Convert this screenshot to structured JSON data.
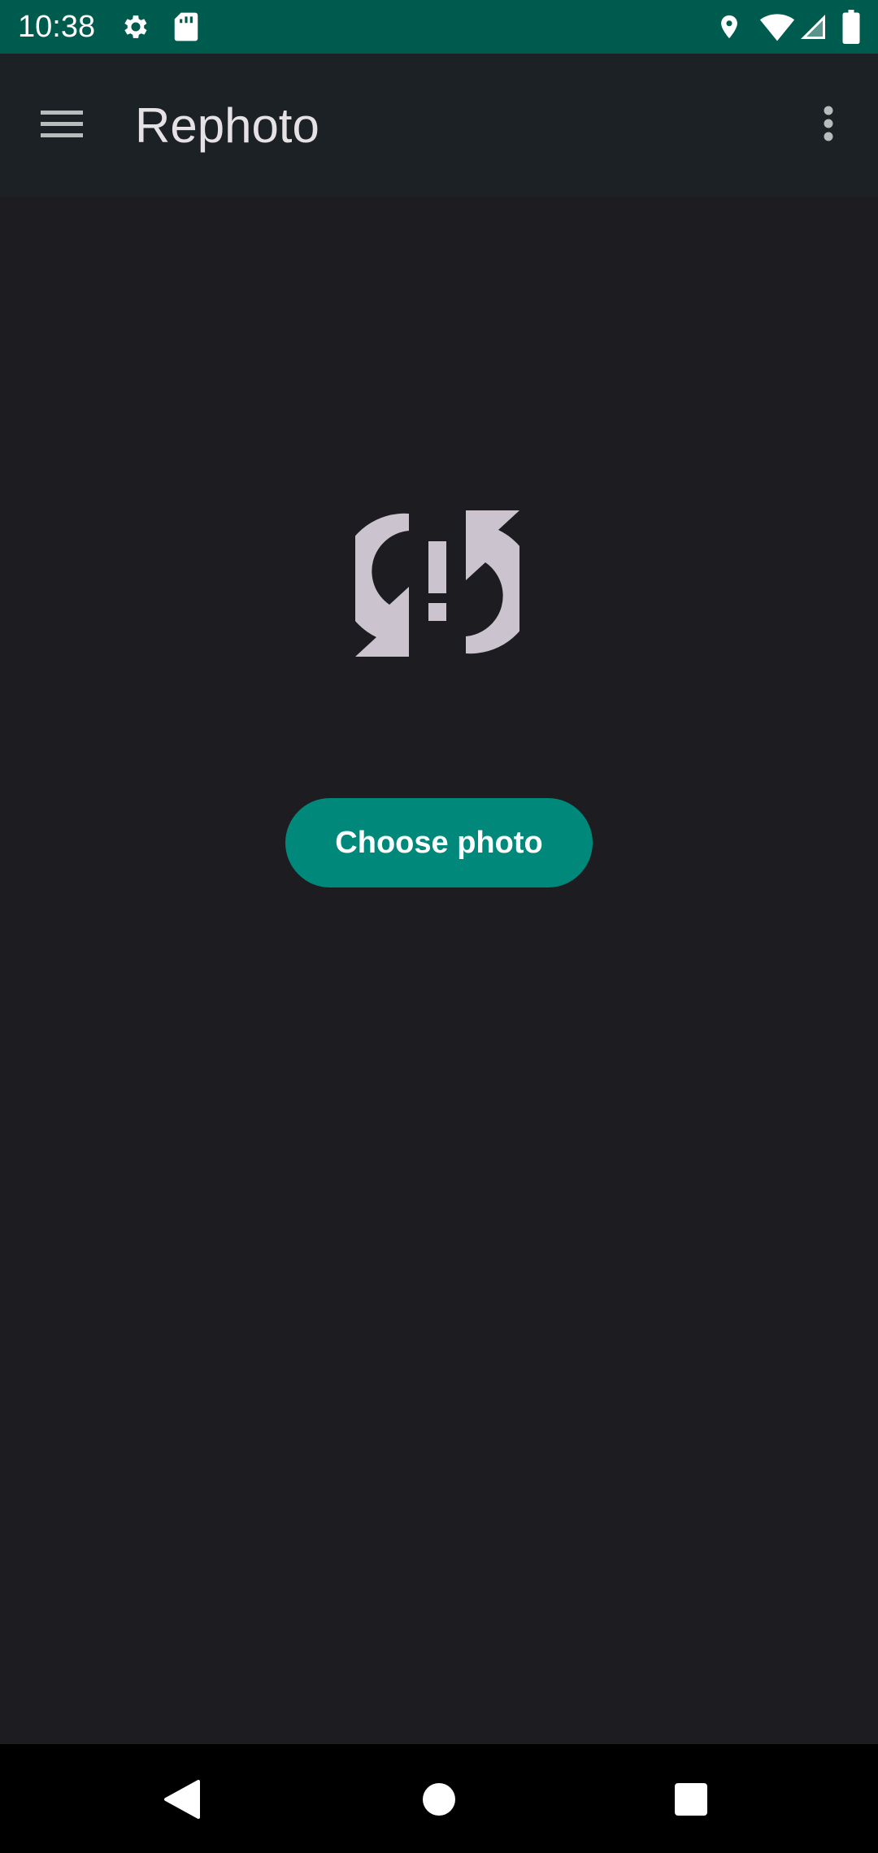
{
  "status_bar": {
    "time": "10:38",
    "left_icons": [
      "gear-icon",
      "sd-card-icon"
    ],
    "right_icons": [
      "location-icon",
      "wifi-icon",
      "cell-signal-icon",
      "battery-icon"
    ],
    "background": "#005b4f"
  },
  "app_bar": {
    "title": "Rephoto",
    "menu_icon": "hamburger-menu-icon",
    "overflow_icon": "more-vert-icon",
    "background": "#1b2124"
  },
  "main": {
    "placeholder_icon": "sync-problem-icon",
    "choose_button_label": "Choose photo",
    "accent": "#00897b",
    "background": "#1c1c21"
  },
  "nav_bar": {
    "icons": [
      "back-icon",
      "home-icon",
      "recents-icon"
    ]
  }
}
